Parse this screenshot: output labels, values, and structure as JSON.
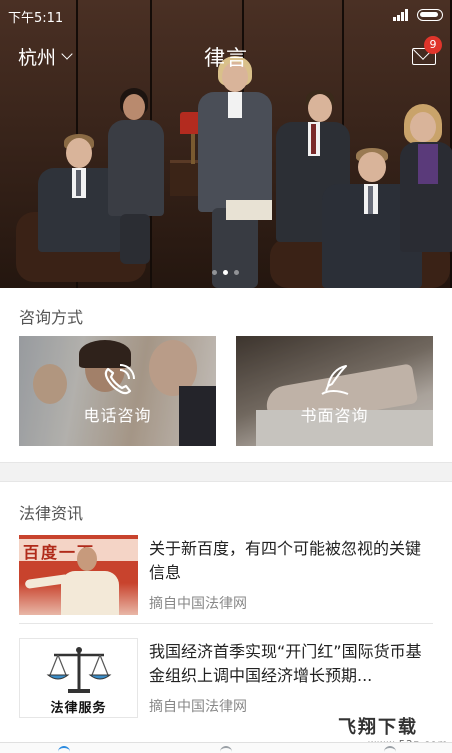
{
  "status_bar": {
    "time": "下午5:11"
  },
  "header": {
    "city": "杭州",
    "title": "律言",
    "unread_count": "9"
  },
  "carousel": {
    "slide_count": 3,
    "active_index": 1
  },
  "consult": {
    "title": "咨询方式",
    "items": [
      {
        "label": "电话咨询",
        "icon": "phone-icon"
      },
      {
        "label": "书面咨询",
        "icon": "quill-icon"
      }
    ]
  },
  "news": {
    "title": "法律资讯",
    "items": [
      {
        "headline": "关于新百度，有四个可能被忽视的关键信息",
        "source": "摘自中国法律网",
        "thumb_text": "百度一下"
      },
      {
        "headline": "我国经济首季实现“开门红”国际货币基金组织上调中国经济增长预期...",
        "source": "摘自中国法律网",
        "thumb_text": "法律服务"
      }
    ]
  },
  "watermark": {
    "main": "飞翔下载",
    "sub": "www.52z.com"
  },
  "colors": {
    "badge": "#e0352b",
    "text_primary": "#222222",
    "text_secondary": "#888888"
  }
}
